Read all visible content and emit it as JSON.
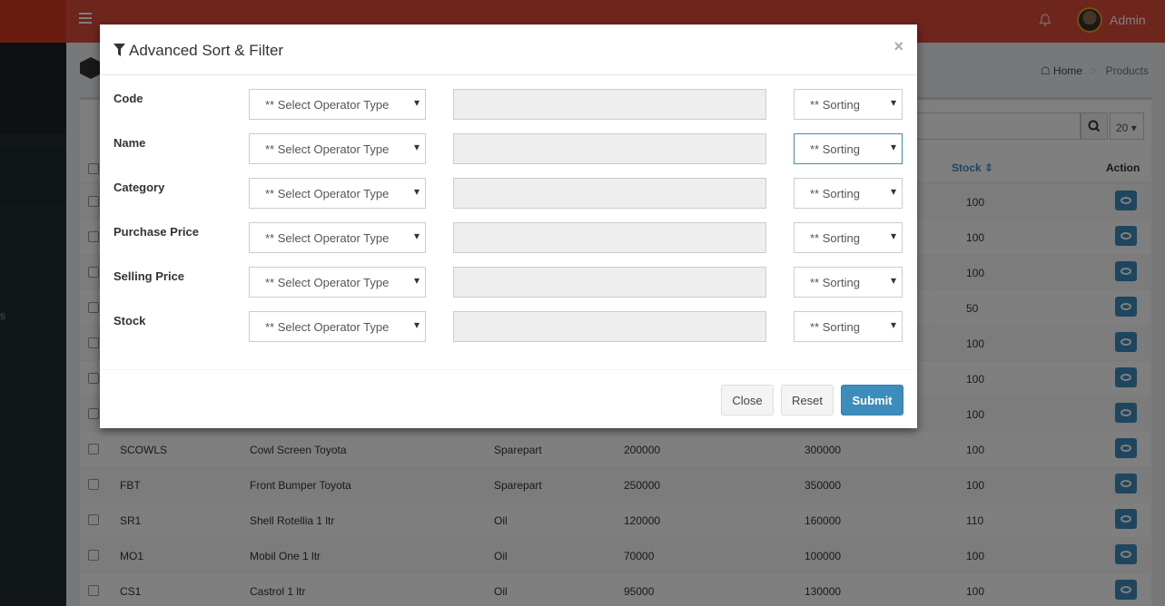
{
  "header": {
    "user_name": "Admin"
  },
  "sidebar": {
    "partial_label": "s"
  },
  "breadcrumb": {
    "home": "Home",
    "current": "Products"
  },
  "toolbar": {
    "per_page": "20"
  },
  "table": {
    "columns": {
      "stock": "Stock",
      "action": "Action"
    },
    "rows": [
      {
        "code": "",
        "name": "",
        "category": "",
        "purchase": "",
        "selling": "",
        "stock": "100"
      },
      {
        "code": "",
        "name": "",
        "category": "",
        "purchase": "",
        "selling": "",
        "stock": "100"
      },
      {
        "code": "",
        "name": "",
        "category": "",
        "purchase": "",
        "selling": "",
        "stock": "100"
      },
      {
        "code": "",
        "name": "",
        "category": "",
        "purchase": "",
        "selling": "",
        "stock": "50"
      },
      {
        "code": "",
        "name": "",
        "category": "",
        "purchase": "",
        "selling": "",
        "stock": "100"
      },
      {
        "code": "",
        "name": "",
        "category": "",
        "purchase": "",
        "selling": "",
        "stock": "100"
      },
      {
        "code": "",
        "name": "",
        "category": "",
        "purchase": "",
        "selling": "",
        "stock": "100"
      },
      {
        "code": "SCOWLS",
        "name": "Cowl Screen Toyota",
        "category": "Sparepart",
        "purchase": "200000",
        "selling": "300000",
        "stock": "100"
      },
      {
        "code": "FBT",
        "name": "Front Bumper Toyota",
        "category": "Sparepart",
        "purchase": "250000",
        "selling": "350000",
        "stock": "100"
      },
      {
        "code": "SR1",
        "name": "Shell Rotellia 1 ltr",
        "category": "Oil",
        "purchase": "120000",
        "selling": "160000",
        "stock": "110"
      },
      {
        "code": "MO1",
        "name": "Mobil One 1 ltr",
        "category": "Oil",
        "purchase": "70000",
        "selling": "100000",
        "stock": "100"
      },
      {
        "code": "CS1",
        "name": "Castrol 1 ltr",
        "category": "Oil",
        "purchase": "95000",
        "selling": "130000",
        "stock": "100"
      }
    ]
  },
  "modal": {
    "title": "Advanced Sort & Filter",
    "close_symbol": "×",
    "operator_placeholder": "** Select Operator Type",
    "sorting_placeholder": "** Sorting",
    "fields": [
      {
        "label": "Code"
      },
      {
        "label": "Name"
      },
      {
        "label": "Category"
      },
      {
        "label": "Purchase Price"
      },
      {
        "label": "Selling Price"
      },
      {
        "label": "Stock"
      }
    ],
    "buttons": {
      "close": "Close",
      "reset": "Reset",
      "submit": "Submit"
    }
  },
  "colors": {
    "header": "#dd4b39",
    "sidebar": "#222d32",
    "primary": "#3c8dbc"
  },
  "icons": [
    "hamburger-icon",
    "bell-icon",
    "filter-icon",
    "home-icon",
    "search-icon",
    "sort-icon",
    "eye-icon"
  ]
}
